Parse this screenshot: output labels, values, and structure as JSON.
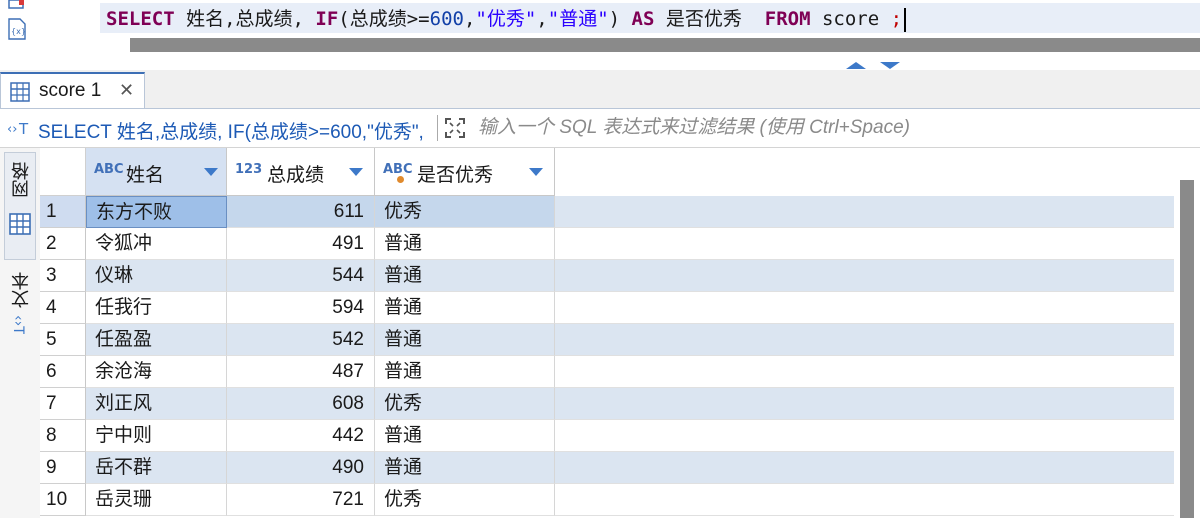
{
  "editor": {
    "sql": {
      "kw_select": "SELECT",
      "cols": " 姓名,总成绩, ",
      "kw_if": "IF",
      "cond_open": "(总成绩>=",
      "cond_num": "600",
      "comma1": ",",
      "str_good": "\"优秀\"",
      "comma2": ",",
      "str_normal": "\"普通\"",
      "close": ") ",
      "kw_as": "AS",
      "alias": " 是否优秀  ",
      "kw_from": "FROM",
      "table": " score ",
      "semi": ";"
    }
  },
  "tab": {
    "label": "score 1",
    "close_glyph": "✕"
  },
  "filter": {
    "sql_preview": "SELECT 姓名,总成绩, IF(总成绩>=600,\"优秀\",",
    "placeholder": "输入一个 SQL 表达式来过滤结果 (使用 Ctrl+Space)"
  },
  "side": {
    "grid_label": "网格",
    "text_label": "文本"
  },
  "columns": [
    {
      "type": "ABC",
      "name": "姓名"
    },
    {
      "type": "123",
      "name": "总成绩"
    },
    {
      "type": "ABC",
      "name": "是否优秀"
    }
  ],
  "rows": [
    {
      "n": "1",
      "name": "东方不败",
      "score": "611",
      "flag": "优秀"
    },
    {
      "n": "2",
      "name": "令狐冲",
      "score": "491",
      "flag": "普通"
    },
    {
      "n": "3",
      "name": "仪琳",
      "score": "544",
      "flag": "普通"
    },
    {
      "n": "4",
      "name": "任我行",
      "score": "594",
      "flag": "普通"
    },
    {
      "n": "5",
      "name": "任盈盈",
      "score": "542",
      "flag": "普通"
    },
    {
      "n": "6",
      "name": "余沧海",
      "score": "487",
      "flag": "普通"
    },
    {
      "n": "7",
      "name": "刘正风",
      "score": "608",
      "flag": "优秀"
    },
    {
      "n": "8",
      "name": "宁中则",
      "score": "442",
      "flag": "普通"
    },
    {
      "n": "9",
      "name": "岳不群",
      "score": "490",
      "flag": "普通"
    },
    {
      "n": "10",
      "name": "岳灵珊",
      "score": "721",
      "flag": "优秀"
    }
  ],
  "colors": {
    "keyword": "#7f0055",
    "number": "#1240a8",
    "string": "#2a00ff",
    "accent": "#3d79c9",
    "row_alt": "#dbe5f1",
    "selected_cell": "#9ebfe8"
  }
}
